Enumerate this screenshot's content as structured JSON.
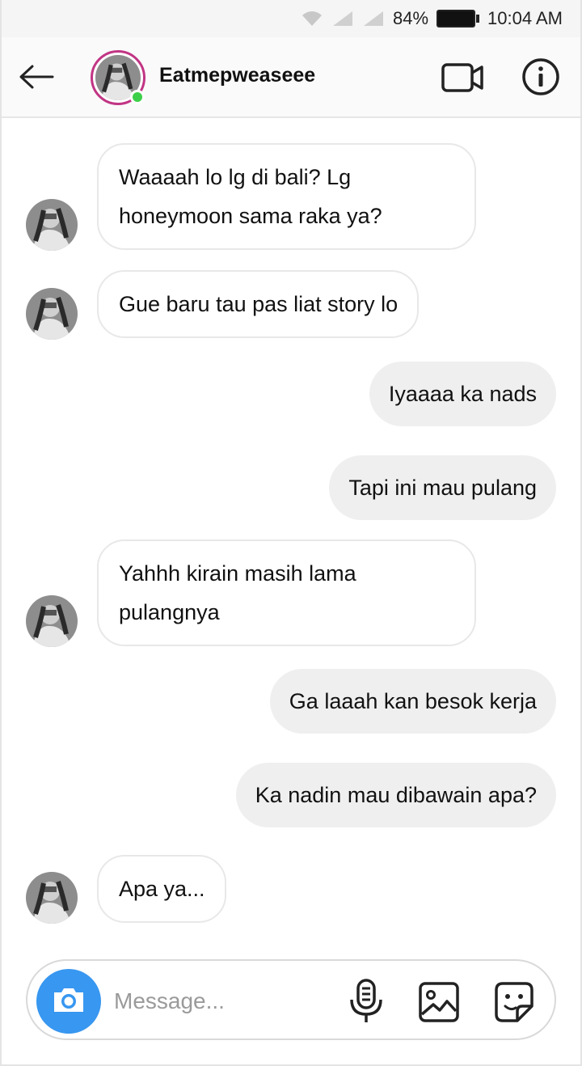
{
  "status_bar": {
    "battery_percent": "84%",
    "time": "10:04 AM",
    "icons": [
      "wifi-icon",
      "signal-icon",
      "signal-icon",
      "battery-icon"
    ]
  },
  "header": {
    "username": "Eatmepweaseee",
    "online": true,
    "story_ring_color": "#c13584",
    "online_color": "#3ecf4a",
    "icons": [
      "back-arrow-icon",
      "video-camera-icon",
      "info-icon"
    ]
  },
  "messages": [
    {
      "direction": "incoming",
      "lines": [
        "Waaaah lo lg di bali? Lg",
        "honeymoon sama raka ya?"
      ]
    },
    {
      "direction": "incoming",
      "lines": [
        "Gue baru tau pas liat story lo"
      ]
    },
    {
      "direction": "outgoing",
      "lines": [
        "Iyaaaa ka nads"
      ]
    },
    {
      "direction": "outgoing",
      "lines": [
        "Tapi ini mau pulang"
      ]
    },
    {
      "direction": "incoming",
      "lines": [
        "Yahhh kirain masih lama",
        "pulangnya"
      ]
    },
    {
      "direction": "outgoing",
      "lines": [
        "Ga laaah kan besok kerja"
      ]
    },
    {
      "direction": "outgoing",
      "lines": [
        "Ka nadin mau dibawain apa?"
      ]
    },
    {
      "direction": "incoming",
      "lines": [
        "Apa ya..."
      ]
    }
  ],
  "composer": {
    "placeholder": "Message...",
    "camera_color": "#3897f0",
    "icons": [
      "camera-icon",
      "microphone-icon",
      "gallery-icon",
      "sticker-icon"
    ]
  }
}
